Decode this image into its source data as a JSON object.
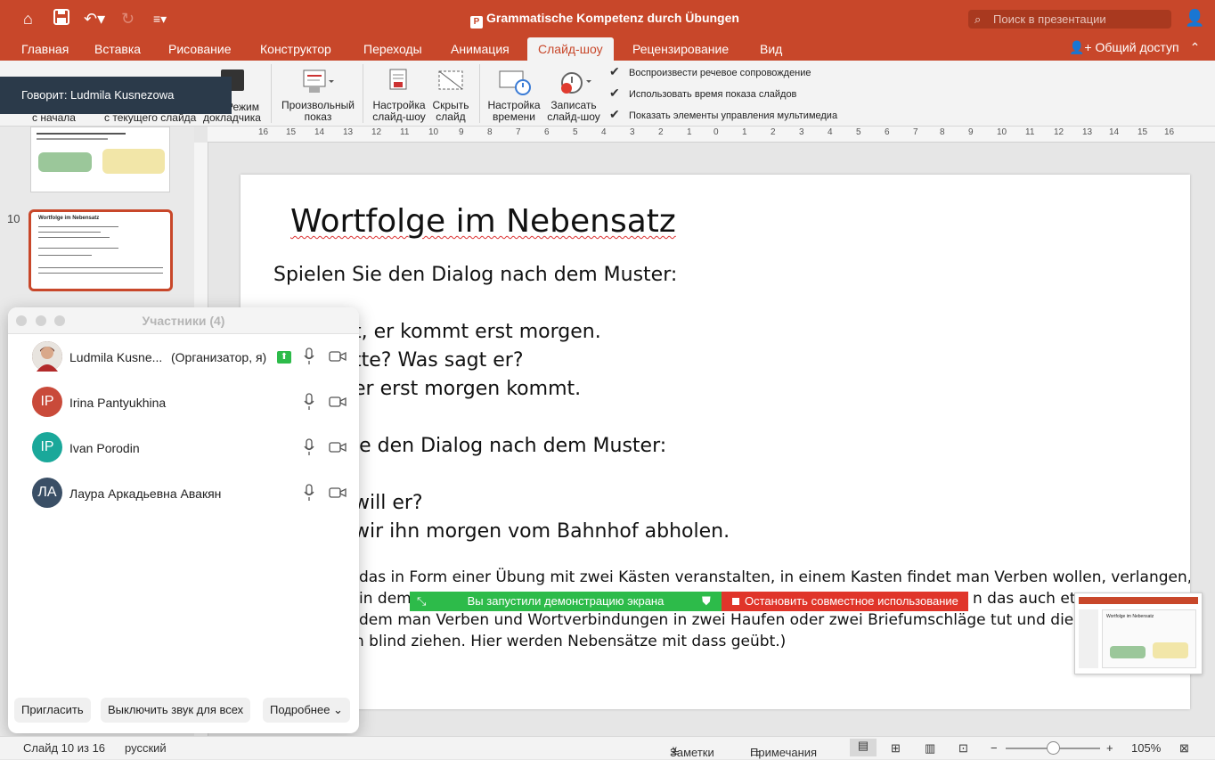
{
  "window": {
    "title": "Grammatische Kompetenz durch Übungen",
    "search_placeholder": "Поиск в презентации"
  },
  "tabs": [
    "Главная",
    "Вставка",
    "Рисование",
    "Конструктор",
    "Переходы",
    "Анимация",
    "Слайд-шоу",
    "Рецензирование",
    "Вид"
  ],
  "share_label": "Общий доступ",
  "speaker": "Говорит: Ludmila Kusnezowa",
  "ribbon": {
    "from_start": "с начала",
    "from_current": "с текущего слайда",
    "presenter_a": "Режим",
    "presenter_b": "докладчика",
    "custom_a": "Произвольный",
    "custom_b": "показ",
    "setup_a": "Настройка",
    "setup_b": "слайд-шоу",
    "hide_a": "Скрыть",
    "hide_b": "слайд",
    "timing_a": "Настройка",
    "timing_b": "времени",
    "record_a": "Записать",
    "record_b": "слайд-шоу",
    "checks": [
      "Воспроизвести речевое сопровождение",
      "Использовать время показа слайдов",
      "Показать элементы управления мультимедиа"
    ]
  },
  "thumbs": {
    "current_num": "10",
    "current_title": "Wortfolge im Nebensatz"
  },
  "ruler": [
    "16",
    "15",
    "14",
    "13",
    "12",
    "11",
    "10",
    "9",
    "8",
    "7",
    "6",
    "5",
    "4",
    "3",
    "2",
    "1",
    "0",
    "1",
    "2",
    "3",
    "4",
    "5",
    "6",
    "7",
    "8",
    "9",
    "10",
    "11",
    "12",
    "13",
    "14",
    "15",
    "16"
  ],
  "slide": {
    "title": "Wortfolge im Nebensatz",
    "line1": "Spielen Sie den Dialog nach dem Muster:",
    "line2": "t, er kommt erst morgen.",
    "line3": "tte? Was sagt er?",
    "line4": "er erst morgen kommt.",
    "line5": "ie den Dialog nach dem Muster:",
    "line6": "will er?",
    "line7": "wir ihn morgen vom Bahnhof abholen.",
    "small1": "das in Form einer Übung mit zwei Kästen veranstalten, in einem Kasten findet man Verben wollen, verlangen,",
    "small2_a": "in dem",
    "small2_b": "n das auch etw",
    "small3": "dem man Verben und Wortverbindungen in zwei Haufen oder zwei Briefumschläge tut und die Schü",
    "small4": "n blind ziehen. Hier werden Nebensätze mit dass geübt.)"
  },
  "participants": {
    "title": "Участники (4)",
    "list": [
      {
        "name": "Ludmila Kusne...",
        "role": "(Организатор, я)",
        "initials": "",
        "color": "#a33"
      },
      {
        "name": "Irina Pantyukhina",
        "role": "",
        "initials": "IP",
        "color": "#c94a3a"
      },
      {
        "name": "Ivan Porodin",
        "role": "",
        "initials": "IP",
        "color": "#1aa89a"
      },
      {
        "name": "Лаура Аркадьевна Авакян",
        "role": "",
        "initials": "ЛА",
        "color": "#3a4f66"
      }
    ],
    "invite": "Пригласить",
    "mute_all": "Выключить звук для всех",
    "more": "Подробнее"
  },
  "sharebar": {
    "started": "Вы запустили демонстрацию экрана",
    "stop": "Остановить совместное использование"
  },
  "status": {
    "slide": "Слайд 10 из 16",
    "lang": "русский",
    "notes": "Заметки",
    "comments": "Примечания",
    "zoom": "105%"
  },
  "colors": {
    "accent": "#c8472a",
    "share_green": "#2dbb4a",
    "share_red": "#e0352a"
  }
}
